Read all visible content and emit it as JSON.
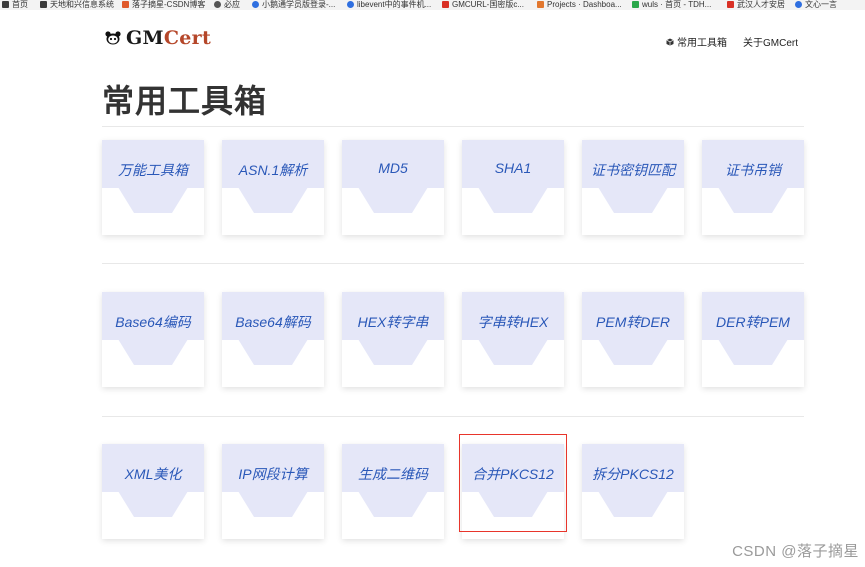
{
  "bookmarks": [
    {
      "label": "首页",
      "color": "#3b3b3b"
    },
    {
      "label": "天地和兴信息系统",
      "color": "#3b3b3b"
    },
    {
      "label": "落子摘星-CSDN博客",
      "color": "#e05a2b"
    },
    {
      "label": "必应",
      "color": "#555555"
    },
    {
      "label": "小鹅通学员版登录-...",
      "color": "#2f6fe0"
    },
    {
      "label": "libevent中的事件机...",
      "color": "#2f6fe0"
    },
    {
      "label": "GMCURL-国密版c...",
      "color": "#d93025"
    },
    {
      "label": "Projects · Dashboa...",
      "color": "#e2772e"
    },
    {
      "label": "wuls · 首页 - TDH...",
      "color": "#2aa84a"
    },
    {
      "label": "武汉人才安居",
      "color": "#d93025"
    },
    {
      "label": "文心一言",
      "color": "#2f6fe0"
    }
  ],
  "header": {
    "logo_prefix": "GM",
    "logo_suffix": "Cert",
    "nav_toolbox": "常用工具箱",
    "nav_about": "关于GMCert"
  },
  "page_title": "常用工具箱",
  "tools_rows": [
    [
      "万能工具箱",
      "ASN.1解析",
      "MD5",
      "SHA1",
      "证书密钥匹配",
      "证书吊销"
    ],
    [
      "Base64编码",
      "Base64解码",
      "HEX转字串",
      "字串转HEX",
      "PEM转DER",
      "DER转PEM"
    ],
    [
      "XML美化",
      "IP网段计算",
      "生成二维码",
      "合并PKCS12",
      "拆分PKCS12"
    ]
  ],
  "highlighted_tool": "合并PKCS12",
  "watermark": "CSDN @落子摘星",
  "colors": {
    "card_top": "#e5e7f8",
    "card_label": "#2a58b8",
    "highlight_border": "#e8352b",
    "logo_cert": "#b5472a"
  }
}
